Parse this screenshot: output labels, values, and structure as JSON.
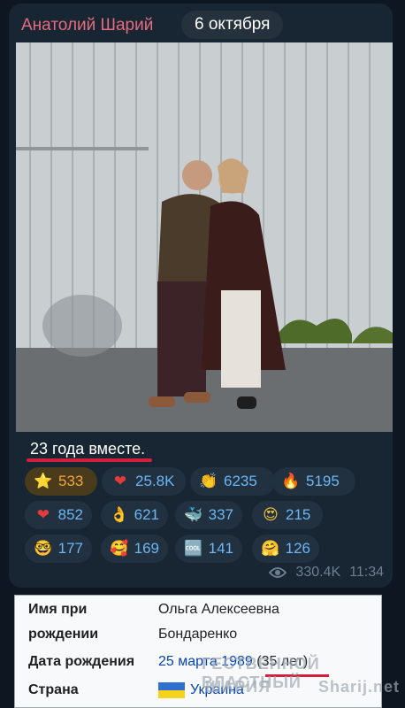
{
  "message": {
    "sender": "Анатолий Шарий",
    "date": "6 октября",
    "caption": "23 года вместе.",
    "views": "330.4K",
    "time": "11:34"
  },
  "reactions": [
    {
      "emoji": "star",
      "count": "533",
      "selected": true
    },
    {
      "emoji": "heart",
      "count": "25.8K"
    },
    {
      "emoji": "clap",
      "count": "6235"
    },
    {
      "emoji": "fire",
      "count": "5195"
    },
    {
      "emoji": "heart-on-fire",
      "count": "852"
    },
    {
      "emoji": "ok-hand",
      "count": "621"
    },
    {
      "emoji": "whale",
      "count": "337"
    },
    {
      "emoji": "heart-eyes",
      "count": "215"
    },
    {
      "emoji": "nerd-face",
      "count": "177"
    },
    {
      "emoji": "smiling-hearts",
      "count": "169"
    },
    {
      "emoji": "cool",
      "count": "141"
    },
    {
      "emoji": "hugging-face",
      "count": "126"
    }
  ],
  "wiki": {
    "birth_name_label_1": "Имя при",
    "birth_name_label_2": "рождении",
    "birth_name_1": "Ольга Алексеевна",
    "birth_name_2": "Бондаренко",
    "dob_label": "Дата рождения",
    "dob_link": "25 марта 1989",
    "dob_age": "(35 лет)",
    "country_label": "Страна",
    "country": "Украина"
  },
  "watermark": {
    "line1": "ГЕСТВЕННОЙ ВЛАСТНЫЙ",
    "line2": "ШАРИЯ",
    "site": "Sharij.net"
  },
  "colors": {
    "sender": "#e66b7f",
    "accent": "#6cb6f5",
    "underline": "#d21f3c",
    "bg": "#0e1621",
    "bubble": "#182533"
  }
}
